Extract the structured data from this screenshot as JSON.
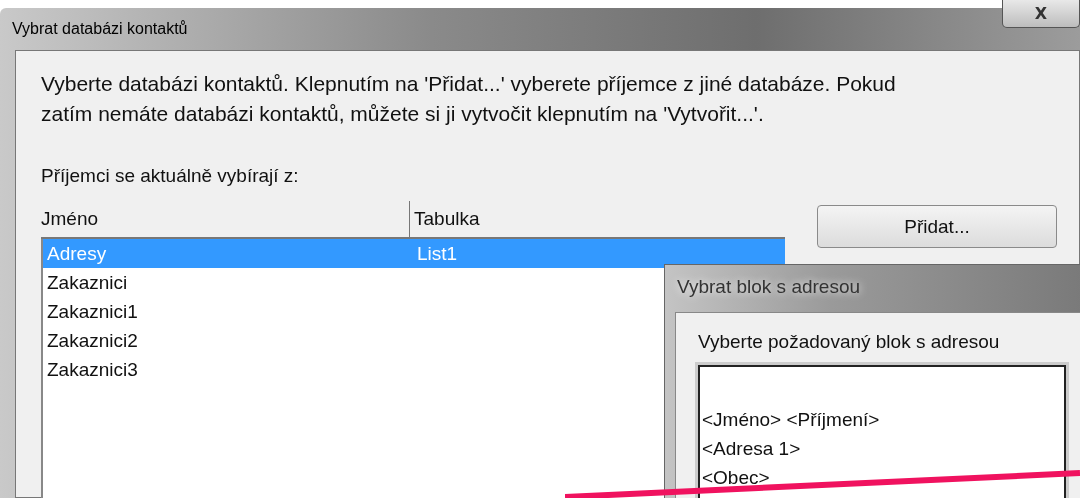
{
  "window": {
    "title": "Vybrat databázi kontaktů",
    "close_label": "X"
  },
  "intro": "Vyberte databázi kontaktů. Klepnutím na 'Přidat...' vyberete příjemce z jiné databáze. Pokud zatím nemáte databázi kontaktů, můžete si ji vytvočit klepnutím na 'Vytvořit...'.",
  "source_label": "Příjemci se aktuálně vybírají z:",
  "table": {
    "columns": [
      "Jméno",
      "Tabulka"
    ],
    "rows": [
      {
        "cells": [
          "Adresy",
          "List1"
        ],
        "selected": true
      },
      {
        "cells": [
          "Zakaznici"
        ],
        "selected": false
      },
      {
        "cells": [
          "Zakaznici1"
        ],
        "selected": false
      },
      {
        "cells": [
          "Zakaznici2"
        ],
        "selected": false
      },
      {
        "cells": [
          "Zakaznici3"
        ],
        "selected": false
      }
    ]
  },
  "buttons": [
    "Přidat..."
  ],
  "address_dialog": {
    "title": "Vybrat blok s adresou",
    "prompt": "Vyberte požadovaný blok s adresou",
    "preview_lines": [
      "<Jméno> <Příjmení>",
      "<Adresa 1>",
      "<Obec>"
    ]
  }
}
